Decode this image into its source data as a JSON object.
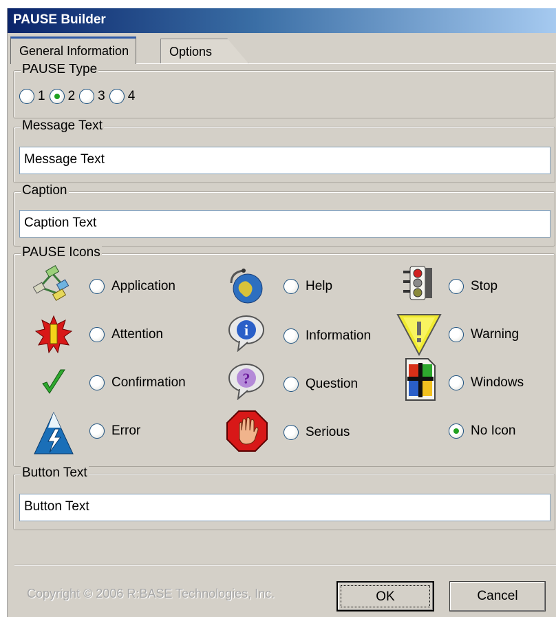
{
  "window": {
    "title": "PAUSE Builder"
  },
  "tabs": [
    {
      "label": "General Information",
      "active": true
    },
    {
      "label": "Options",
      "active": false
    }
  ],
  "pause_type": {
    "legend": "PAUSE Type",
    "options": [
      "1",
      "2",
      "3",
      "4"
    ],
    "selected": "2"
  },
  "message": {
    "legend": "Message Text",
    "value": "Message Text"
  },
  "caption": {
    "legend": "Caption",
    "value": "Caption Text"
  },
  "icons": {
    "legend": "PAUSE Icons",
    "selected": "No Icon",
    "items": [
      {
        "label": "Application",
        "icon": "application-icon"
      },
      {
        "label": "Help",
        "icon": "help-globe-icon"
      },
      {
        "label": "Stop",
        "icon": "traffic-light-icon"
      },
      {
        "label": "Attention",
        "icon": "attention-burst-icon"
      },
      {
        "label": "Information",
        "icon": "information-bubble-icon"
      },
      {
        "label": "Warning",
        "icon": "warning-triangle-icon"
      },
      {
        "label": "Confirmation",
        "icon": "checkmark-icon"
      },
      {
        "label": "Question",
        "icon": "question-bubble-icon"
      },
      {
        "label": "Windows",
        "icon": "windows-document-icon"
      },
      {
        "label": "Error",
        "icon": "error-lightning-icon"
      },
      {
        "label": "Serious",
        "icon": "stop-hand-icon"
      },
      {
        "label": "No Icon",
        "icon": ""
      }
    ]
  },
  "button_text": {
    "legend": "Button Text",
    "value": "Button Text"
  },
  "footer": {
    "copyright": "Copyright © 2006 R:BASE Technologies, Inc.",
    "ok_label": "OK",
    "cancel_label": "Cancel"
  }
}
